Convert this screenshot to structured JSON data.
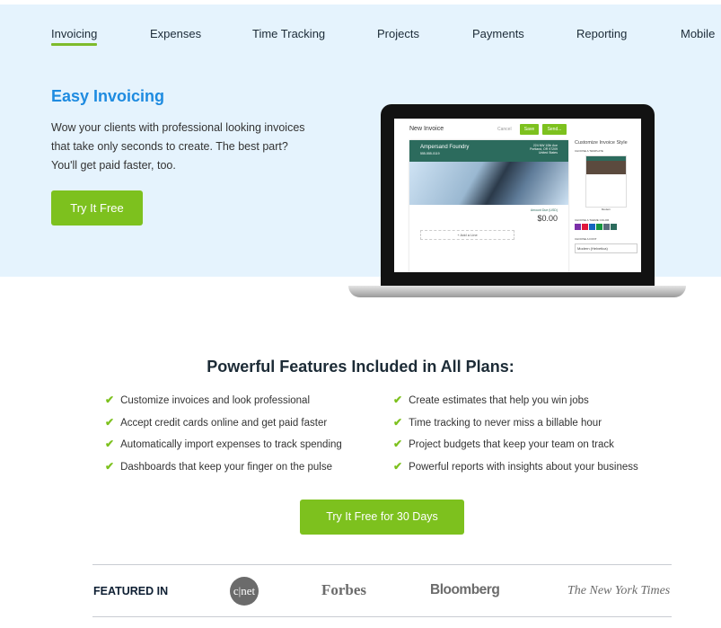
{
  "nav": {
    "items": [
      {
        "label": "Invoicing",
        "active": true
      },
      {
        "label": "Expenses"
      },
      {
        "label": "Time Tracking"
      },
      {
        "label": "Projects"
      },
      {
        "label": "Payments"
      },
      {
        "label": "Reporting"
      },
      {
        "label": "Mobile"
      }
    ]
  },
  "hero": {
    "title": "Easy Invoicing",
    "text": "Wow your clients with professional looking invoices that take only seconds to create. The best part? You'll get paid faster, too.",
    "cta": "Try It Free"
  },
  "mockup": {
    "title": "New Invoice",
    "cancel": "Cancel",
    "save": "Save",
    "send": "Send...",
    "company": "Ampersand Foundry",
    "phone": "555-555-0119",
    "address": "224 NW 10th Ave Portland, OR 97209 United States",
    "amount": "$0.00",
    "amount_label": "Amount Due (USD)",
    "add_line": "+ Add a Line",
    "customize": "Customize Invoice Style",
    "choose_template": "CHOOSE A TEMPLATE",
    "template_name": "Modern",
    "choose_color": "CHOOSE A THEME COLOR",
    "choose_font": "CHOOSE A FONT",
    "font": "Modern (Helvetica)",
    "colors": [
      "#7b2fa8",
      "#e0173c",
      "#1565c0",
      "#16963f",
      "#5a6b7b",
      "#2c6b5d"
    ]
  },
  "features": {
    "title": "Powerful Features Included in All Plans:",
    "left": [
      "Customize invoices and look professional",
      "Accept credit cards online and get paid faster",
      "Automatically import expenses to track spending",
      "Dashboards that keep your finger on the pulse"
    ],
    "right": [
      "Create estimates that help you win jobs",
      "Time tracking to never miss a billable hour",
      "Project budgets that keep your team on track",
      "Powerful reports with insights about your business"
    ],
    "cta": "Try It Free for 30 Days"
  },
  "featured": {
    "label": "FEATURED IN",
    "logos": [
      "c|net",
      "Forbes",
      "Bloomberg",
      "The New York Times"
    ]
  },
  "colors": {
    "accent": "#7dc11e",
    "link": "#1e8be0",
    "hero_bg": "#e5f3fd"
  }
}
